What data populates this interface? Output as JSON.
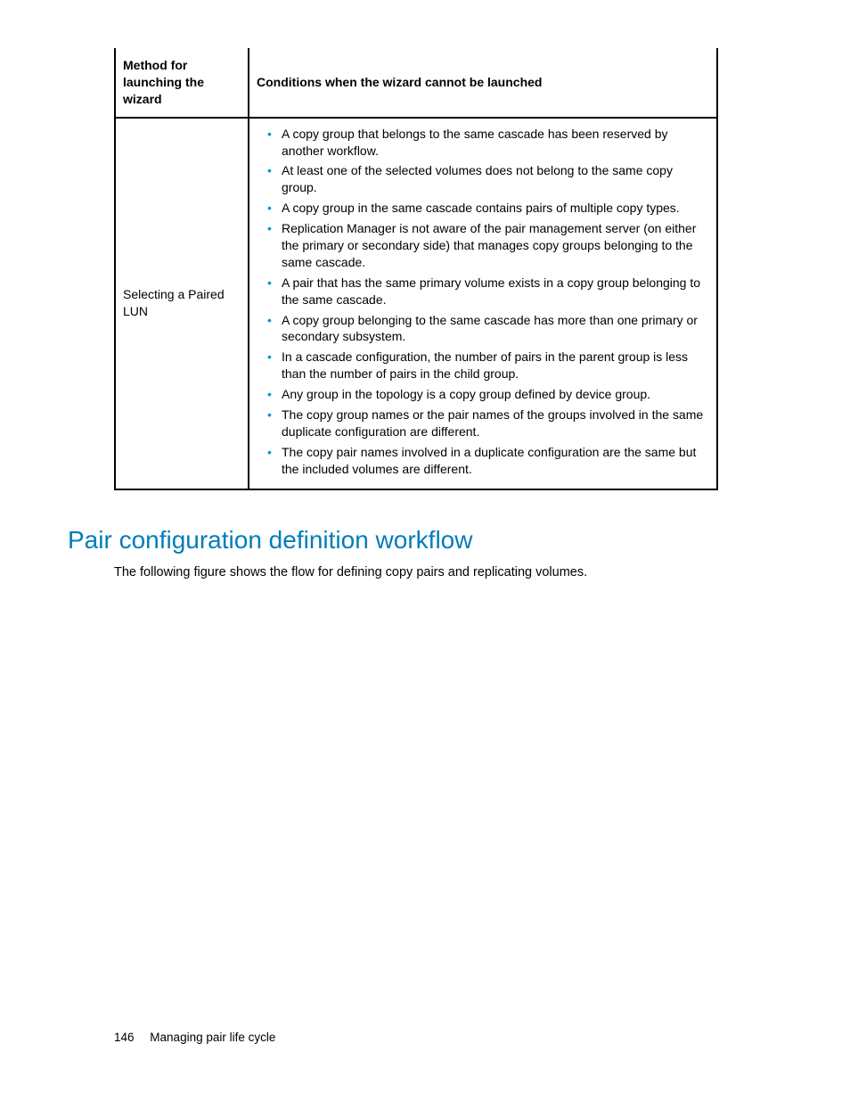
{
  "table": {
    "headers": {
      "left": "Method for launching the wizard",
      "right": "Conditions when the wizard cannot be launched"
    },
    "row": {
      "method": "Selecting a Paired LUN",
      "conditions": [
        "A copy group that belongs to the same cascade has been reserved by another workflow.",
        "At least one of the selected volumes does not belong to the same copy group.",
        "A copy group in the same cascade contains pairs of multiple copy types.",
        "Replication Manager is not aware of the pair management server (on either the primary or secondary side) that manages copy groups belonging to the same cascade.",
        "A pair that has the same primary volume exists in a copy group belonging to the same cascade.",
        "A copy group belonging to the same cascade has more than one primary or secondary subsystem.",
        "In a cascade configuration, the number of pairs in the parent group is less than the number of pairs in the child group.",
        "Any group in the topology is a copy group defined by device group.",
        "The copy group names or the pair names of the groups involved in the same duplicate configuration are different.",
        "The copy pair names involved in a duplicate configuration are the same but the included volumes are different."
      ]
    }
  },
  "section": {
    "heading": "Pair configuration definition workflow",
    "intro": "The following figure shows the flow for defining copy pairs and replicating volumes."
  },
  "footer": {
    "page": "146",
    "title": "Managing pair life cycle"
  }
}
